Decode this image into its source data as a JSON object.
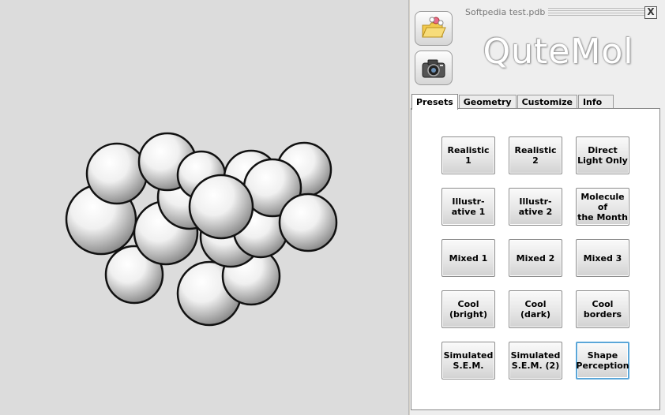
{
  "window": {
    "title": "Softpedia test.pdb",
    "close_label": "X"
  },
  "logo": "QuteMol",
  "toolbar": {
    "open_icon": "open-folder-icon",
    "snapshot_icon": "camera-icon"
  },
  "tabs": [
    {
      "label": "Presets",
      "active": true
    },
    {
      "label": "Geometry",
      "active": false
    },
    {
      "label": "Customize",
      "active": false
    },
    {
      "label": "Info",
      "active": false
    }
  ],
  "presets": [
    {
      "label": "Realistic\n1"
    },
    {
      "label": "Realistic\n2"
    },
    {
      "label": "Direct\nLight Only"
    },
    {
      "label": "Illustr-\native 1"
    },
    {
      "label": "Illustr-\native 2"
    },
    {
      "label": "Molecule of\nthe Month"
    },
    {
      "label": "Mixed 1"
    },
    {
      "label": "Mixed 2"
    },
    {
      "label": "Mixed 3"
    },
    {
      "label": "Cool\n(bright)"
    },
    {
      "label": "Cool\n(dark)"
    },
    {
      "label": "Cool\nborders"
    },
    {
      "label": "Simulated\nS.E.M."
    },
    {
      "label": "Simulated\nS.E.M. (2)"
    },
    {
      "label": "Shape\nPerception",
      "selected": true
    }
  ],
  "colors": {
    "accent": "#5aa6d8",
    "viewport_bg": "#dcdcdc"
  }
}
